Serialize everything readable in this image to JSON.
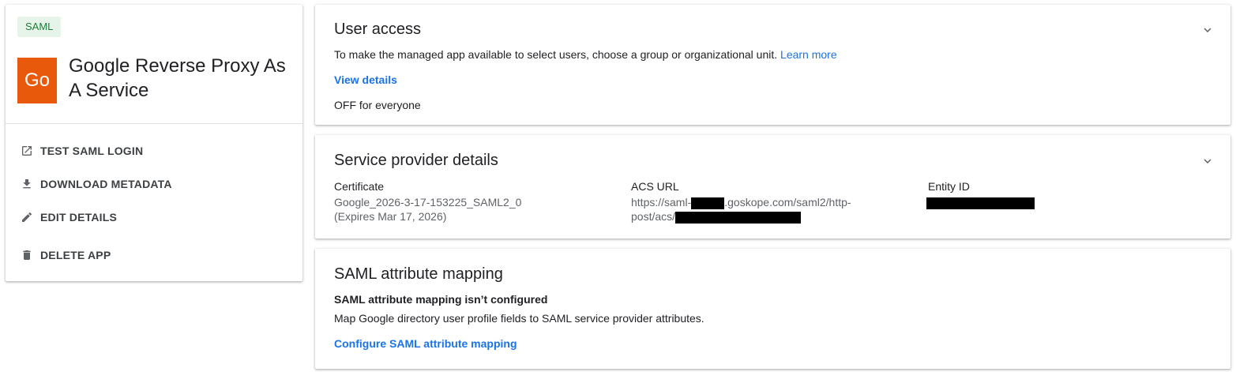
{
  "app": {
    "badge": "SAML",
    "logo_text": "Go",
    "logo_color": "#e8590c",
    "name": "Google Reverse Proxy As A Service",
    "actions": [
      {
        "label": "TEST SAML LOGIN",
        "icon": "open-in-new-icon"
      },
      {
        "label": "DOWNLOAD METADATA",
        "icon": "download-icon"
      },
      {
        "label": "EDIT DETAILS",
        "icon": "pencil-icon"
      },
      {
        "label": "DELETE APP",
        "icon": "trash-icon"
      }
    ]
  },
  "user_access": {
    "title": "User access",
    "description": "To make the managed app available to select users, choose a group or organizational unit.",
    "learn_more": "Learn more",
    "view_details": "View details",
    "status": "OFF for everyone"
  },
  "service_provider": {
    "title": "Service provider details",
    "certificate_label": "Certificate",
    "certificate_value": "Google_2026-3-17-153225_SAML2_0",
    "certificate_expiry": "(Expires Mar 17, 2026)",
    "acs_label": "ACS URL",
    "acs_prefix": "https://saml-",
    "acs_middle": ".goskope.com/saml2/http-",
    "acs_line2": "post/acs/",
    "entity_label": "Entity ID"
  },
  "attribute_mapping": {
    "title": "SAML attribute mapping",
    "status": "SAML attribute mapping isn’t configured",
    "description": "Map Google directory user profile fields to SAML service provider attributes.",
    "configure_link": "Configure SAML attribute mapping"
  },
  "colors": {
    "link": "#1a73e8",
    "badge_bg": "#e6f4ea",
    "badge_text": "#188038"
  }
}
